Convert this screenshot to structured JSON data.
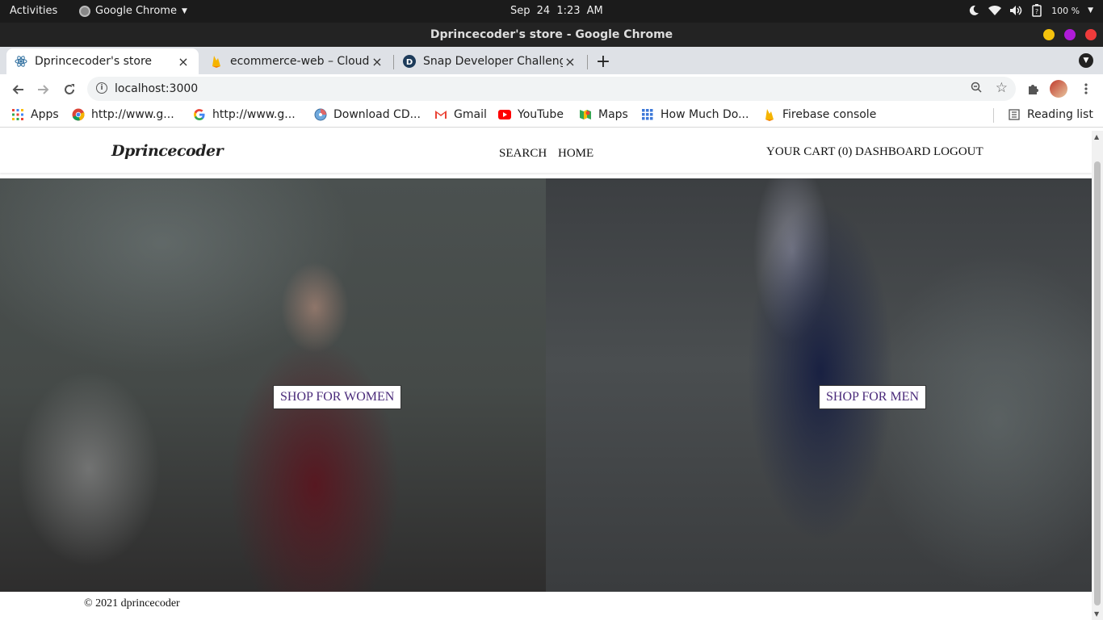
{
  "system": {
    "activities": "Activities",
    "app_name": "Google Chrome",
    "date": "Sep 24",
    "time": "1:23 AM",
    "battery": "100 %"
  },
  "window": {
    "title": "Dprincecoder's store - Google Chrome"
  },
  "tabs": [
    {
      "title": "Dprincecoder's store",
      "close": "×"
    },
    {
      "title": "ecommerce-web – Cloud Firestore",
      "close": "×"
    },
    {
      "title": "Snap Developer Challenge",
      "close": "×"
    }
  ],
  "toolbar": {
    "url": "localhost:3000"
  },
  "bookmarks": [
    {
      "label": "Apps"
    },
    {
      "label": "http://www.g..."
    },
    {
      "label": "http://www.g..."
    },
    {
      "label": "Download CD..."
    },
    {
      "label": "Gmail"
    },
    {
      "label": "YouTube"
    },
    {
      "label": "Maps"
    },
    {
      "label": "How Much Do..."
    },
    {
      "label": "Firebase console"
    }
  ],
  "reading_list": "Reading list",
  "site": {
    "brand": "Dprincecoder",
    "nav": {
      "search": "SEARCH",
      "home": "HOME",
      "cart": "YOUR CART (0)",
      "dashboard": "DASHBOARD",
      "logout": "LOGOUT"
    },
    "hero": {
      "women_button": "SHOP FOR WOMEN",
      "men_button": "SHOP FOR MEN"
    },
    "footer": "© 2021 dprincecoder"
  }
}
